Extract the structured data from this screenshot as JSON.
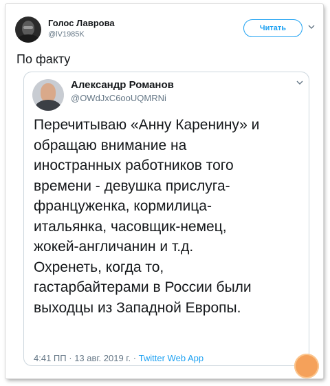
{
  "tweet": {
    "author_name": "Голос Лаврова",
    "author_handle": "@lV1985K",
    "follow_label": "Читать",
    "text": "По факту"
  },
  "quoted_tweet": {
    "author_name": "Александр Романов",
    "author_handle": "@OWdJxC6ooUQMRNi",
    "lines": [
      "Перечитываю «Анну Каренину» и",
      "обращаю внимание на",
      "иностранных работников того",
      "времени - девушка прислуга-",
      "француженка, кормилица-",
      "итальянка, часовщик-немец,",
      "жокей-англичанин и т.д.",
      "Охренеть, когда то,",
      "гастарбайтерами в России были",
      "выходцы из Западной Европы."
    ],
    "time": "4:41 ПП",
    "date": "13 авг. 2019 г.",
    "source": "Twitter Web App"
  },
  "watermark": "Ника",
  "colors": {
    "accent": "#1da1f2",
    "secondary_text": "#657786",
    "border": "#ccd6dd"
  },
  "icons": {
    "menu": "chevron-down-icon"
  }
}
